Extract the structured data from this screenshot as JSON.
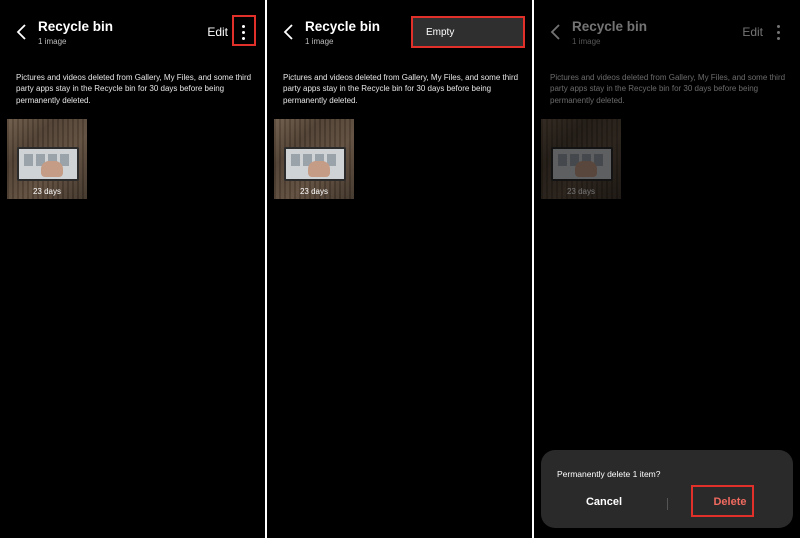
{
  "colors": {
    "background": "#000000",
    "highlight": "#e1302a",
    "delete_text": "#f06a5f",
    "dialog_bg": "#2a2a2a",
    "popup_bg": "#2f2f2f"
  },
  "header": {
    "title": "Recycle bin",
    "subtitle": "1 image",
    "edit_label": "Edit",
    "back_icon": "chevron-left-icon",
    "more_icon": "more-vertical-icon"
  },
  "description": "Pictures and videos deleted from Gallery, My Files, and some third party apps stay in the Recycle bin for 30 days before being permanently deleted.",
  "item": {
    "days_label": "23 days"
  },
  "menu": {
    "empty_label": "Empty"
  },
  "dialog": {
    "message": "Permanently delete 1 item?",
    "cancel_label": "Cancel",
    "delete_label": "Delete"
  }
}
